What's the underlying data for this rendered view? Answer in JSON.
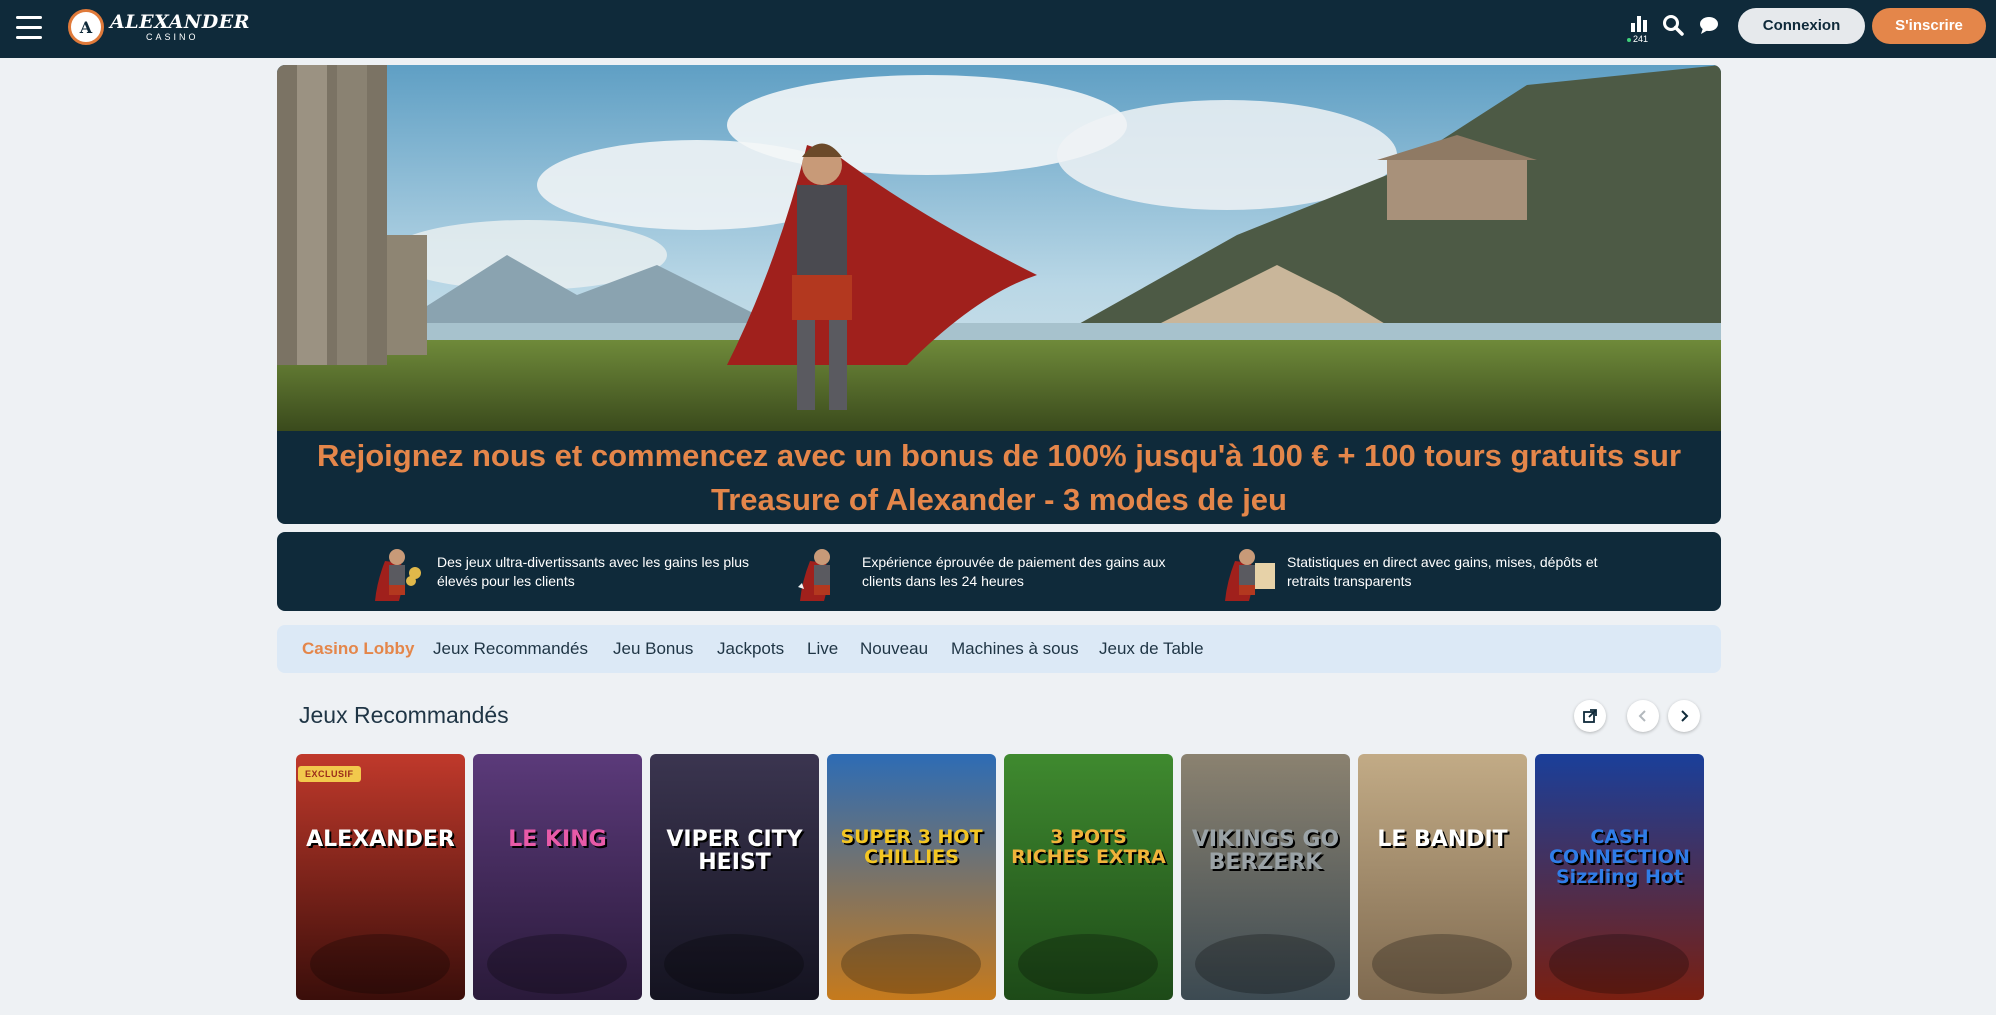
{
  "header": {
    "logo_name": "ALEXANDER",
    "logo_sub": "CASINO",
    "online_count": "241",
    "login_label": "Connexion",
    "signup_label": "S'inscrire"
  },
  "hero": {
    "headline_line1": "Rejoignez nous et commencez avec un bonus de 100% jusqu'à 100 € + 100 tours gratuits sur",
    "headline_line2": "Treasure of Alexander - 3 modes de jeu"
  },
  "features": [
    {
      "text": "Des jeux ultra-divertissants avec les gains les plus élevés pour les clients"
    },
    {
      "text": "Expérience éprouvée de paiement des gains aux clients dans les 24 heures"
    },
    {
      "text": "Statistiques en direct avec gains, mises, dépôts et retraits transparents"
    }
  ],
  "tabs": [
    {
      "label": "Casino Lobby",
      "active": true
    },
    {
      "label": "Jeux Recommandés"
    },
    {
      "label": "Jeu Bonus"
    },
    {
      "label": "Jackpots"
    },
    {
      "label": "Live"
    },
    {
      "label": "Nouveau"
    },
    {
      "label": "Machines à sous"
    },
    {
      "label": "Jeux de Table"
    }
  ],
  "section": {
    "title": "Jeux Recommandés"
  },
  "games": [
    {
      "title": "ALEXANDER",
      "badge": "EXCLUSIF",
      "bg1": "#c0392b",
      "bg2": "#3a0e0a"
    },
    {
      "title": "LE KING",
      "bg1": "#5b3a7a",
      "bg2": "#2a1a3a"
    },
    {
      "title": "VIPER CITY HEIST",
      "bg1": "#3b3550",
      "bg2": "#141320"
    },
    {
      "title": "SUPER 3 HOT CHILLIES",
      "bg1": "#2d6cb5",
      "bg2": "#c67a1c"
    },
    {
      "title": "3 POTS RICHES EXTRA",
      "bg1": "#3f8a2f",
      "bg2": "#1d4a18"
    },
    {
      "title": "VIKINGS GO BERZERK",
      "bg1": "#8b8270",
      "bg2": "#3c4a52"
    },
    {
      "title": "LE BANDIT",
      "bg1": "#c2ab86",
      "bg2": "#7f6a50"
    },
    {
      "title": "CASH CONNECTION Sizzling Hot",
      "bg1": "#1a3f9a",
      "bg2": "#7a1f10"
    }
  ],
  "colors": {
    "navy": "#0f2a3a",
    "orange": "#e4864a",
    "tab_bg": "#dce9f6"
  }
}
